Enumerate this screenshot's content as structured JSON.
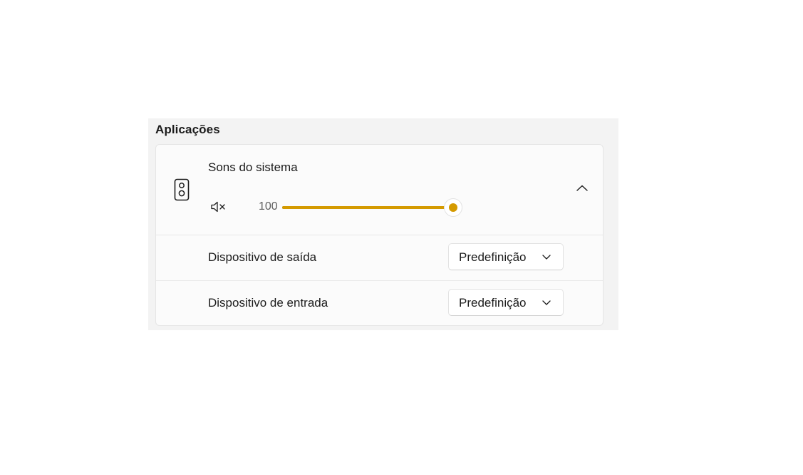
{
  "section": {
    "title": "Aplicações"
  },
  "app": {
    "name": "Sons do sistema",
    "icon": "speaker-icon",
    "mute_icon": "speaker-muted-icon",
    "volume": {
      "value_label": "100",
      "value": 100,
      "min": 0,
      "max": 100
    },
    "expanded": true
  },
  "devices": {
    "output": {
      "label": "Dispositivo de saída",
      "value": "Predefinição"
    },
    "input": {
      "label": "Dispositivo de entrada",
      "value": "Predefinição"
    }
  },
  "colors": {
    "accent": "#d49a00",
    "panel_bg": "#f3f3f3",
    "card_bg": "#fbfbfb"
  }
}
